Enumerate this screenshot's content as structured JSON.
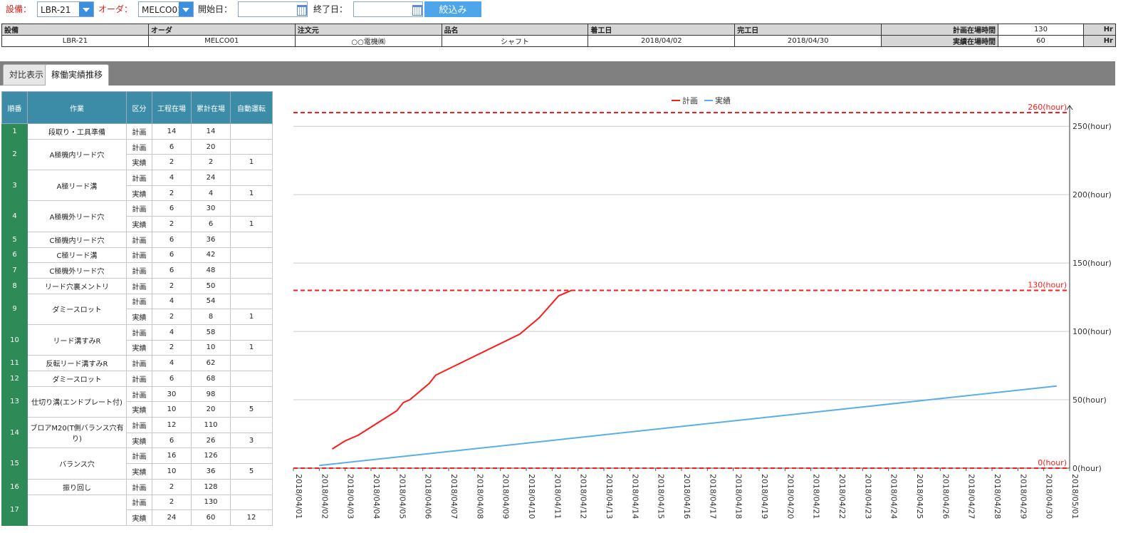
{
  "filter": {
    "equipment_label": "設備：",
    "equipment_value": "LBR-21",
    "order_label": "オーダ：",
    "order_value": "MELCO01",
    "start_label": "開始日：",
    "start_value": "",
    "end_label": "終了日：",
    "end_value": "",
    "submit_label": "絞込み"
  },
  "info": {
    "h_equipment": "設備",
    "h_order": "オーダ",
    "h_customer": "注文元",
    "h_product": "品名",
    "h_start": "着工日",
    "h_end": "完工日",
    "h_plan_time": "計画在場時間",
    "h_actual_time": "実績在場時間",
    "unit": "Hr",
    "equipment": "LBR-21",
    "order": "MELCO01",
    "customer": "○○電機㈱",
    "product": "シャフト",
    "start_date": "2018/04/02",
    "end_date": "2018/04/30",
    "plan_time": "130",
    "actual_time": "60"
  },
  "tabs": {
    "compare": "対比表示",
    "trend": "稼働実績推移"
  },
  "work_table": {
    "headers": [
      "順番",
      "作業",
      "区分",
      "工程在場",
      "累計在場",
      "自動運転"
    ],
    "groups": [
      {
        "no": "1",
        "name": "段取り・工具準備",
        "rows": [
          [
            "計画",
            "14",
            "14",
            ""
          ]
        ]
      },
      {
        "no": "2",
        "name": "A極機内リード穴",
        "rows": [
          [
            "計画",
            "6",
            "20",
            ""
          ],
          [
            "実績",
            "2",
            "2",
            "1"
          ]
        ]
      },
      {
        "no": "3",
        "name": "A極リード溝",
        "rows": [
          [
            "計画",
            "4",
            "24",
            ""
          ],
          [
            "実績",
            "2",
            "4",
            "1"
          ]
        ]
      },
      {
        "no": "4",
        "name": "A極機外リード穴",
        "rows": [
          [
            "計画",
            "6",
            "30",
            ""
          ],
          [
            "実績",
            "2",
            "6",
            "1"
          ]
        ]
      },
      {
        "no": "5",
        "name": "C極機内リード穴",
        "rows": [
          [
            "計画",
            "6",
            "36",
            ""
          ]
        ]
      },
      {
        "no": "6",
        "name": "C極リード溝",
        "rows": [
          [
            "計画",
            "6",
            "42",
            ""
          ]
        ]
      },
      {
        "no": "7",
        "name": "C極機外リード穴",
        "rows": [
          [
            "計画",
            "6",
            "48",
            ""
          ]
        ]
      },
      {
        "no": "8",
        "name": "リード穴裏メントリ",
        "rows": [
          [
            "計画",
            "2",
            "50",
            ""
          ]
        ]
      },
      {
        "no": "9",
        "name": "ダミースロット",
        "rows": [
          [
            "計画",
            "4",
            "54",
            ""
          ],
          [
            "実績",
            "2",
            "8",
            "1"
          ]
        ]
      },
      {
        "no": "10",
        "name": "リード溝すみR",
        "rows": [
          [
            "計画",
            "4",
            "58",
            ""
          ],
          [
            "実績",
            "2",
            "10",
            "1"
          ]
        ]
      },
      {
        "no": "11",
        "name": "反転リード溝すみR",
        "rows": [
          [
            "計画",
            "4",
            "62",
            ""
          ]
        ]
      },
      {
        "no": "12",
        "name": "ダミースロット",
        "rows": [
          [
            "計画",
            "6",
            "68",
            ""
          ]
        ]
      },
      {
        "no": "13",
        "name": "仕切り溝(エンドプレート付)",
        "rows": [
          [
            "計画",
            "30",
            "98",
            ""
          ],
          [
            "実績",
            "10",
            "20",
            "5"
          ]
        ]
      },
      {
        "no": "14",
        "name": "ブロアM20(T側バランス穴有り)",
        "rows": [
          [
            "計画",
            "12",
            "110",
            ""
          ],
          [
            "実績",
            "6",
            "26",
            "3"
          ]
        ]
      },
      {
        "no": "15",
        "name": "バランス穴",
        "rows": [
          [
            "計画",
            "16",
            "126",
            ""
          ],
          [
            "実績",
            "10",
            "36",
            "5"
          ]
        ]
      },
      {
        "no": "16",
        "name": "振り回し",
        "rows": [
          [
            "計画",
            "2",
            "128",
            ""
          ]
        ]
      },
      {
        "no": "17",
        "name": "",
        "rows": [
          [
            "計画",
            "2",
            "130",
            ""
          ],
          [
            "実績",
            "24",
            "60",
            "12"
          ]
        ]
      }
    ]
  },
  "chart_data": {
    "type": "line",
    "legend": [
      {
        "name": "計画",
        "color": "#ff1a1a"
      },
      {
        "name": "実績",
        "color": "#5aaee8"
      }
    ],
    "legend_position": "top-center",
    "x": [
      "2018/04/01",
      "2018/04/02",
      "2018/04/03",
      "2018/04/04",
      "2018/04/05",
      "2018/04/06",
      "2018/04/07",
      "2018/04/08",
      "2018/04/09",
      "2018/04/10",
      "2018/04/11",
      "2018/04/12",
      "2018/04/13",
      "2018/04/14",
      "2018/04/15",
      "2018/04/16",
      "2018/04/17",
      "2018/04/18",
      "2018/04/19",
      "2018/04/20",
      "2018/04/21",
      "2018/04/22",
      "2018/04/23",
      "2018/04/24",
      "2018/04/25",
      "2018/04/26",
      "2018/04/27",
      "2018/04/28",
      "2018/04/29",
      "2018/04/30",
      "2018/05/01"
    ],
    "y_ticks": [
      "0(hour)",
      "50(hour)",
      "100(hour)",
      "150(hour)",
      "200(hour)",
      "250(hour)"
    ],
    "y_tick_values": [
      0,
      50,
      100,
      150,
      200,
      250
    ],
    "ylim": [
      0,
      260
    ],
    "y_axis_position": "right",
    "grid": true,
    "reference_lines": [
      {
        "value": 260,
        "label": "260(hour)",
        "color": "#ff1a1a"
      },
      {
        "value": 130,
        "label": "130(hour)",
        "color": "#ff1a1a"
      },
      {
        "value": 0,
        "label": "0(hour)",
        "color": "#ff1a1a"
      }
    ],
    "series": [
      {
        "name": "計画",
        "color": "#ff1a1a",
        "points": [
          [
            "2018/04/02 12:00",
            14
          ],
          [
            "2018/04/03 00:00",
            20
          ],
          [
            "2018/04/03 12:00",
            24
          ],
          [
            "2018/04/04 00:00",
            30
          ],
          [
            "2018/04/04 12:00",
            36
          ],
          [
            "2018/04/05 00:00",
            42
          ],
          [
            "2018/04/05 06:00",
            48
          ],
          [
            "2018/04/05 12:00",
            50
          ],
          [
            "2018/04/05 18:00",
            54
          ],
          [
            "2018/04/06 00:00",
            58
          ],
          [
            "2018/04/06 06:00",
            62
          ],
          [
            "2018/04/06 12:00",
            68
          ],
          [
            "2018/04/09 18:00",
            98
          ],
          [
            "2018/04/10 12:00",
            110
          ],
          [
            "2018/04/11 06:00",
            126
          ],
          [
            "2018/04/11 12:00",
            128
          ],
          [
            "2018/04/11 18:00",
            130
          ]
        ]
      },
      {
        "name": "実績",
        "color": "#5aaee8",
        "points": [
          [
            "2018/04/02 00:00",
            2
          ],
          [
            "2018/04/30 12:00",
            60
          ]
        ]
      }
    ]
  }
}
